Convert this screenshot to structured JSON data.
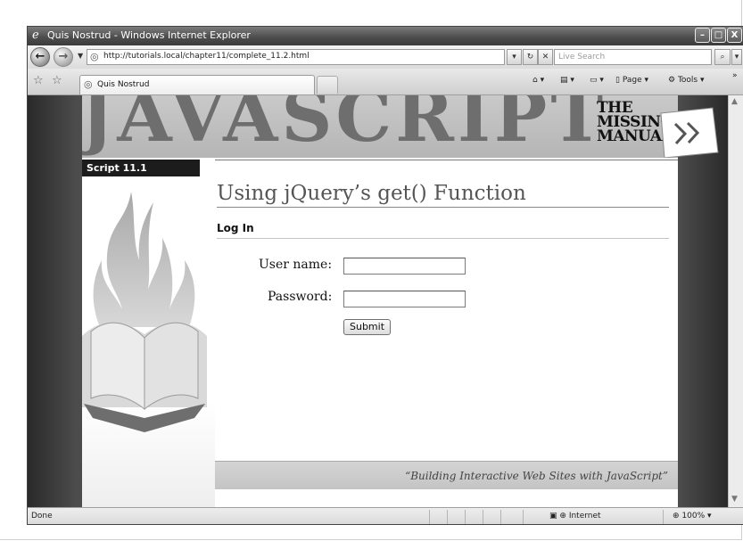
{
  "window": {
    "title": "Quis Nostrud - Windows Internet Explorer",
    "buttons": {
      "minimize": "–",
      "maximize": "□",
      "close": "X"
    }
  },
  "address_bar": {
    "url": "http://tutorials.local/chapter11/complete_11.2.html",
    "search_placeholder": "Live Search"
  },
  "tab": {
    "label": "Quis Nostrud"
  },
  "command_bar": {
    "page": "Page",
    "tools": "Tools"
  },
  "banner": {
    "wordmark": "JAVASCRIPT",
    "subtitle_lines": [
      "THE",
      "MISSING",
      "MANUAL"
    ]
  },
  "sidebar": {
    "label": "Script 11.1"
  },
  "main": {
    "title": "Using jQuery’s get() Function",
    "subheading": "Log In",
    "form": {
      "username_label": "User name:",
      "username_value": "",
      "password_label": "Password:",
      "password_value": "",
      "submit_label": "Submit"
    },
    "footer_quote": "“Building Interactive Web Sites with JavaScript”"
  },
  "status_bar": {
    "status": "Done",
    "zone": "Internet",
    "zoom": "100%"
  },
  "colors": {
    "titlebar": "#4e4e4e",
    "page_background": "#4c4c4c",
    "banner_text": "#6e6e6e",
    "sidebar_label_bg": "#1c1c1c",
    "footer_bg": "#cccccc"
  }
}
